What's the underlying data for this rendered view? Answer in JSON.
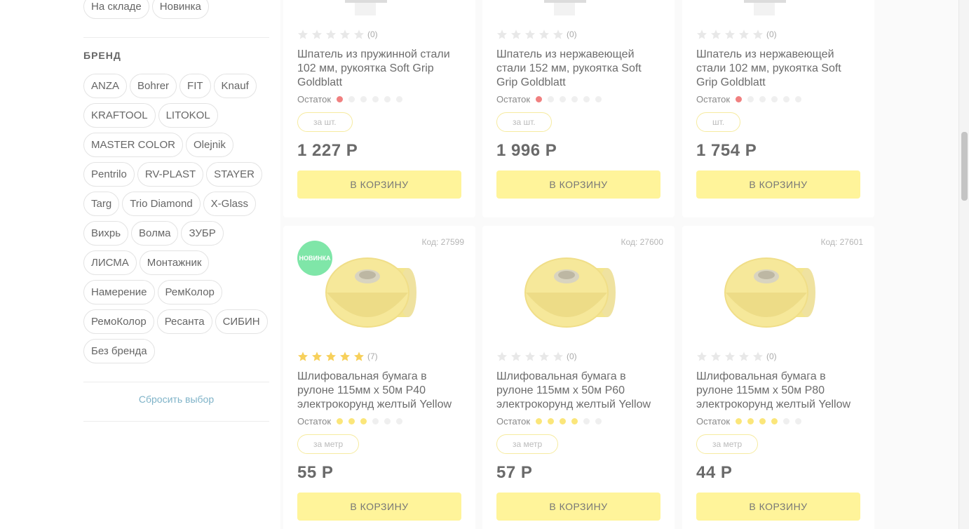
{
  "filters": {
    "availability": [
      "На складе",
      "Новинка"
    ],
    "brand_title": "БРЕНД",
    "brands": [
      "ANZA",
      "Bohrer",
      "FIT",
      "Knauf",
      "KRAFTOOL",
      "LITOKOL",
      "MASTER COLOR",
      "Olejnik",
      "Pentrilo",
      "RV-PLAST",
      "STAYER",
      "Targ",
      "Trio Diamond",
      "X-Glass",
      "Вихрь",
      "Волма",
      "ЗУБР",
      "ЛИСМА",
      "Монтажник",
      "Намерение",
      "РемКолор",
      "РемоКолор",
      "Ресанта",
      "СИБИН",
      "Без бренда"
    ],
    "reset_label": "Сбросить выбор"
  },
  "labels": {
    "stock": "Остаток",
    "cart": "В КОРЗИНУ"
  },
  "products": [
    {
      "code": "",
      "rating": 0,
      "reviews": "(0)",
      "title": "Шпатель из пружинной стали 102 мм, рукоятка Soft Grip Goldblatt",
      "stock_level": 1,
      "stock_color": "#f08080",
      "unit": "за шт.",
      "price": "1 227 Р",
      "badge": ""
    },
    {
      "code": "",
      "rating": 0,
      "reviews": "(0)",
      "title": "Шпатель из нержавеющей стали 152 мм, рукоятка Soft Grip Goldblatt",
      "stock_level": 1,
      "stock_color": "#f08080",
      "unit": "за шт.",
      "price": "1 996 Р",
      "badge": ""
    },
    {
      "code": "",
      "rating": 0,
      "reviews": "(0)",
      "title": "Шпатель из нержавеющей стали 102 мм, рукоятка Soft Grip Goldblatt",
      "stock_level": 1,
      "stock_color": "#f08080",
      "unit": "шт.",
      "price": "1 754 Р",
      "badge": ""
    },
    {
      "code": "Код: 27599",
      "rating": 5,
      "reviews": "(7)",
      "title": "Шлифовальная бумага в рулоне 115мм х 50м P40 электрокорунд желтый Yellow",
      "stock_level": 3,
      "stock_color": "#fbe67a",
      "unit": "за метр",
      "price": "55 Р",
      "badge": "НОВИНКА"
    },
    {
      "code": "Код: 27600",
      "rating": 0,
      "reviews": "(0)",
      "title": "Шлифовальная бумага в рулоне 115мм х 50м P60 электрокорунд желтый Yellow",
      "stock_level": 4,
      "stock_color": "#fbe67a",
      "unit": "за метр",
      "price": "57 Р",
      "badge": ""
    },
    {
      "code": "Код: 27601",
      "rating": 0,
      "reviews": "(0)",
      "title": "Шлифовальная бумага в рулоне 115мм х 50м P80 электрокорунд желтый Yellow",
      "stock_level": 4,
      "stock_color": "#fbe67a",
      "unit": "за метр",
      "price": "44 Р",
      "badge": ""
    }
  ]
}
